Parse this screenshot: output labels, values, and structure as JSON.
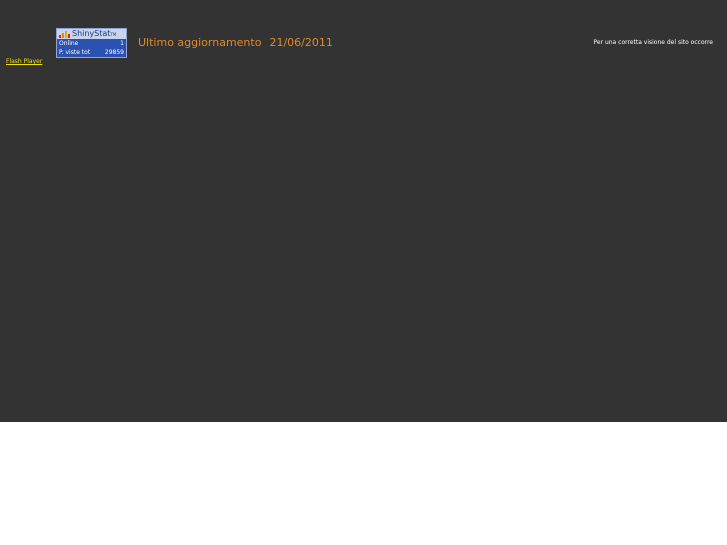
{
  "header": {
    "last_update_label": "Ultimo aggiornamento",
    "last_update_date": "21/06/2011",
    "notice_text": "Per una corretta visione del sito occorre",
    "flash_link": "Flash Player"
  },
  "counter_badge": {
    "brand": "ShinyStat",
    "trademark": "TM",
    "rows": [
      {
        "label": "Online",
        "value": "1"
      },
      {
        "label": "P. viste tot",
        "value": "29859"
      }
    ]
  },
  "colors": {
    "page_background": "#333333",
    "headline_text": "#e08a2a",
    "link_text": "#f0e000",
    "counter_background": "#2b52b0"
  }
}
